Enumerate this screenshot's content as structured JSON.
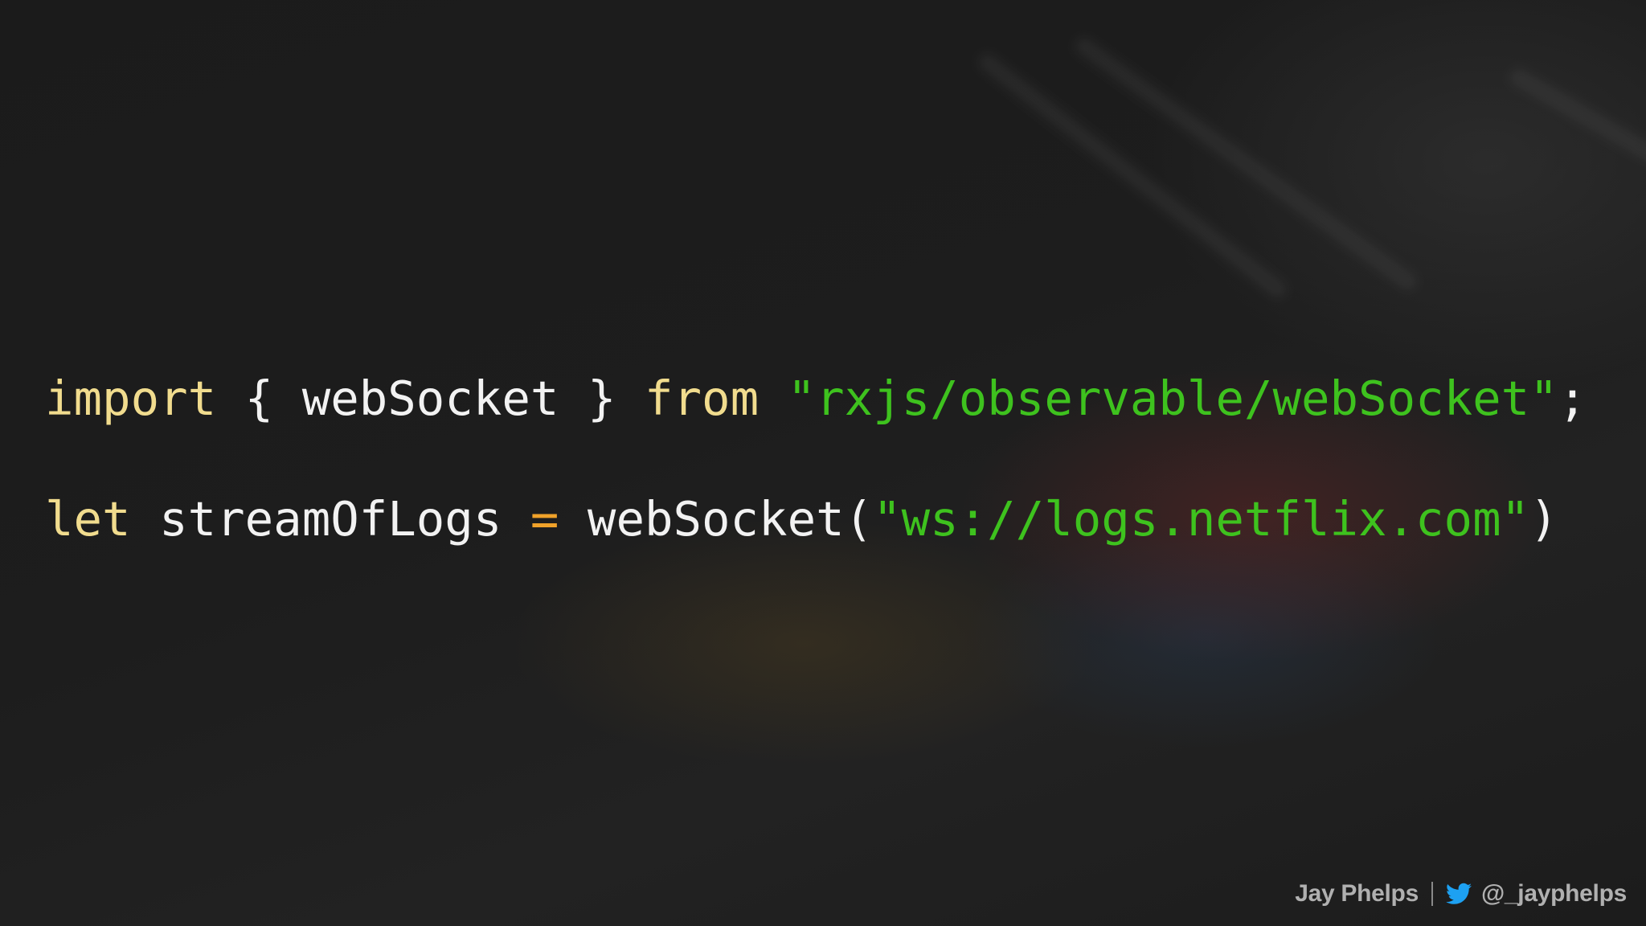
{
  "code": {
    "line1": {
      "keyword_import": "import",
      "open_brace": " { ",
      "identifier": "webSocket",
      "close_brace": " } ",
      "keyword_from": "from",
      "space": " ",
      "string": "\"rxjs/observable/webSocket\"",
      "semicolon": ";"
    },
    "line2": {
      "keyword_let": "let",
      "variable": " streamOfLogs ",
      "operator": "=",
      "call": " webSocket(",
      "string": "\"ws://logs.netflix.com\"",
      "close_paren": ")"
    }
  },
  "footer": {
    "author": "Jay Phelps",
    "handle": "@_jayphelps",
    "icon": "twitter-bird-icon"
  },
  "colors": {
    "keyword": "#f1dc8e",
    "string": "#3ec21e",
    "operator": "#f0a22a",
    "plain": "#f2f2f2",
    "twitter": "#1da1f2"
  }
}
